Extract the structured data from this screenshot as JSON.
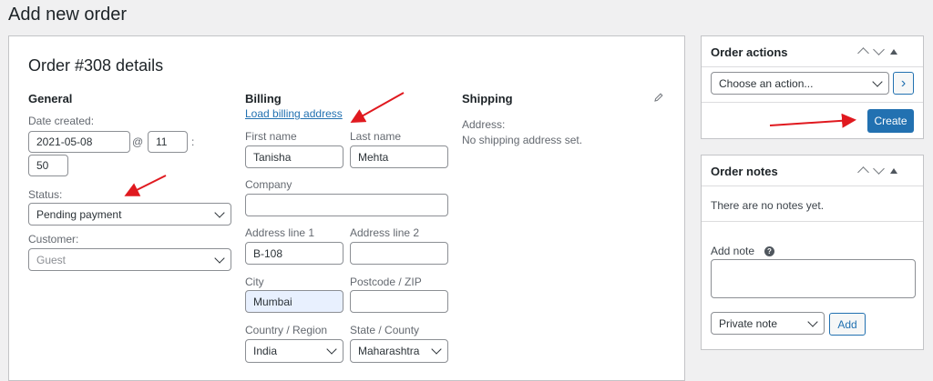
{
  "page": {
    "title": "Add new order"
  },
  "order": {
    "heading": "Order #308 details",
    "general": {
      "title": "General",
      "date_label": "Date created:",
      "date_value": "2021-05-08",
      "at_sign": "@",
      "hour_value": "11",
      "colon": ":",
      "minute_value": "50",
      "status_label": "Status:",
      "status_value": "Pending payment",
      "customer_label": "Customer:",
      "customer_value": "Guest"
    },
    "billing": {
      "title": "Billing",
      "load_link": "Load billing address",
      "first_name_label": "First name",
      "first_name_value": "Tanisha",
      "last_name_label": "Last name",
      "last_name_value": "Mehta",
      "company_label": "Company",
      "company_value": "",
      "address1_label": "Address line 1",
      "address1_value": "B-108",
      "address2_label": "Address line 2",
      "address2_value": "",
      "city_label": "City",
      "city_value": "Mumbai",
      "postcode_label": "Postcode / ZIP",
      "postcode_value": "",
      "country_label": "Country / Region",
      "country_value": "India",
      "state_label": "State / County",
      "state_value": "Maharashtra"
    },
    "shipping": {
      "title": "Shipping",
      "address_label": "Address:",
      "address_value": "No shipping address set."
    }
  },
  "order_actions": {
    "title": "Order actions",
    "select_value": "Choose an action...",
    "go_symbol": "›",
    "create_label": "Create"
  },
  "order_notes": {
    "title": "Order notes",
    "empty_text": "There are no notes yet.",
    "add_note_label": "Add note",
    "help_symbol": "?",
    "note_type_value": "Private note",
    "add_label": "Add"
  },
  "annotations": {
    "arrow_color": "#e0191f"
  }
}
